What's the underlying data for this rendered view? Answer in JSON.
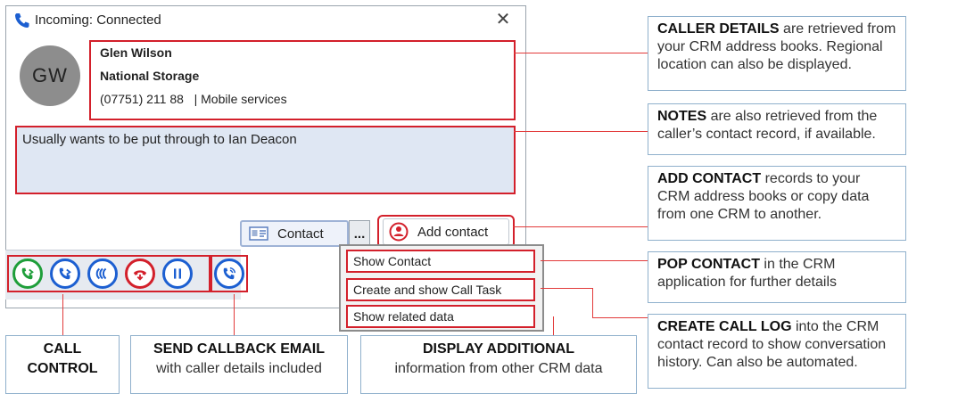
{
  "window": {
    "title": "Incoming: Connected",
    "close_glyph": "✕"
  },
  "caller": {
    "initials": "GW",
    "name": "Glen Wilson",
    "company": "National Storage",
    "phone_line": "(07751) 211 88   | Mobile services"
  },
  "notes": {
    "text": "Usually wants to be put through to Ian Deacon"
  },
  "buttons": {
    "contact_label": "Contact",
    "more_label": "...",
    "add_contact_label": "Add contact"
  },
  "call_controls": [
    {
      "icon": "call-answer-icon",
      "color": "#1e9e3a"
    },
    {
      "icon": "call-transfer-icon",
      "color": "#1c5fd1"
    },
    {
      "icon": "conference-icon",
      "color": "#1c5fd1"
    },
    {
      "icon": "hangup-icon",
      "color": "#d3202b"
    },
    {
      "icon": "pause-icon",
      "color": "#1c5fd1"
    }
  ],
  "callback": {
    "icon": "callback-icon",
    "color": "#1c5fd1"
  },
  "menu": {
    "items": [
      "Show Contact",
      "Create and show Call Task",
      "Show related data"
    ]
  },
  "callouts": {
    "caller_details": {
      "head": "CALLER DETAILS",
      "text": " are retrieved from your CRM address books. Regional location can also be displayed."
    },
    "notes": {
      "head": "NOTES",
      "text": " are also retrieved from the caller’s contact record, if available."
    },
    "add_contact": {
      "head": "ADD CONTACT",
      "text": " records to your CRM address books or copy data from one CRM to another."
    },
    "pop_contact": {
      "head": "POP CONTACT",
      "text": " in the CRM application for further details"
    },
    "create_call_log": {
      "head": "CREATE CALL LOG",
      "text": " into the CRM contact record to show conversation history. Can also be automated."
    },
    "call_control": {
      "line1": "CALL",
      "line2": "CONTROL"
    },
    "send_callback": {
      "head": "SEND CALLBACK EMAIL",
      "text": "with caller details included"
    },
    "display_additional": {
      "head": "DISPLAY ADDITIONAL",
      "text": "information from other CRM data"
    }
  },
  "colors": {
    "highlight": "#d3202b",
    "notes_bg": "#dfe7f3",
    "callout_border": "#8fb0cc"
  }
}
